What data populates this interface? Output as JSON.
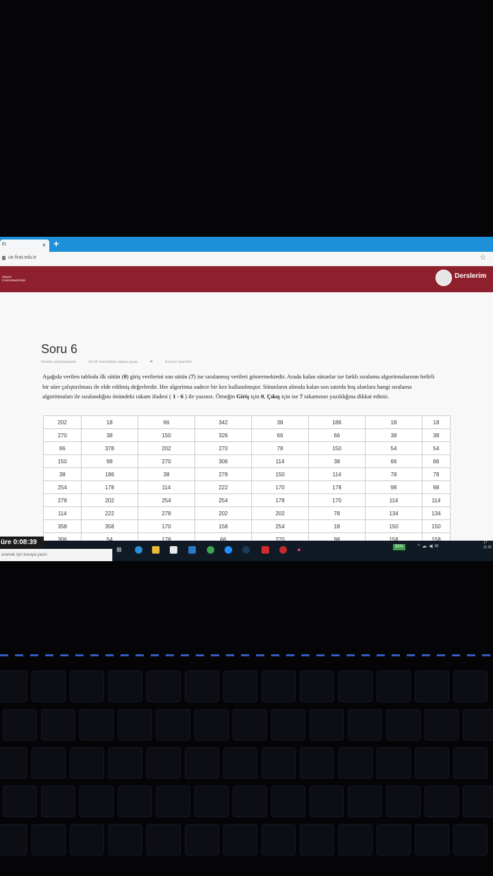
{
  "browser": {
    "tab_title": "Fi",
    "url": "ue.firat.edu.tr"
  },
  "header": {
    "logo_line1": "FIRAT",
    "logo_line2": "ÜNİVERSİTESİ",
    "nav_label": "Derslerim"
  },
  "question": {
    "title": "Soru 6",
    "status": "Henüz yanıtlanmadı",
    "points": "18.00 üzerinden alınan puan",
    "flag": "Soruyu işaretle",
    "text": [
      {
        "t": "Aşağıda verilen tabloda ilk sütün (",
        "b": false
      },
      {
        "t": "0",
        "b": true
      },
      {
        "t": ") giriş verilerini son sütün (",
        "b": false
      },
      {
        "t": "7",
        "b": true
      },
      {
        "t": ") ise sıralanmış verileri göstermektedir. Arada kalan sütunlar ise farklı sıralama algoritmalarının belirli bir süre çalıştırılması ile elde edilmiş değerlerdir. Her algoritma sadece bir kez kullanılmıştır. Sütunların altında kalan son satırda boş alanlara hangi sıralama algoritmaları ile sıralandığını önündeki rakam ifadesi (",
        "b": false
      },
      {
        "t": " 1 - 6 ",
        "b": true
      },
      {
        "t": ") ile yazınız. Örneğin ",
        "b": false
      },
      {
        "t": "Giriş",
        "b": true
      },
      {
        "t": " için ",
        "b": false
      },
      {
        "t": "0",
        "b": true
      },
      {
        "t": ", ",
        "b": false
      },
      {
        "t": "Çıkış",
        "b": true
      },
      {
        "t": " için ise ",
        "b": false
      },
      {
        "t": "7",
        "b": true
      },
      {
        "t": " rakamının yazıldığına dikkat ediniz.",
        "b": false
      }
    ]
  },
  "table": {
    "rows": [
      [
        "202",
        "18",
        "66",
        "342",
        "38",
        "186",
        "18",
        "18"
      ],
      [
        "270",
        "38",
        "150",
        "326",
        "66",
        "66",
        "38",
        "38"
      ],
      [
        "66",
        "378",
        "202",
        "270",
        "78",
        "150",
        "54",
        "54"
      ],
      [
        "150",
        "98",
        "270",
        "306",
        "114",
        "38",
        "66",
        "66"
      ],
      [
        "38",
        "186",
        "38",
        "278",
        "150",
        "114",
        "78",
        "78"
      ],
      [
        "254",
        "178",
        "114",
        "222",
        "170",
        "178",
        "98",
        "98"
      ],
      [
        "278",
        "202",
        "254",
        "254",
        "178",
        "170",
        "114",
        "114"
      ],
      [
        "114",
        "222",
        "278",
        "202",
        "202",
        "78",
        "134",
        "134"
      ],
      [
        "358",
        "358",
        "170",
        "158",
        "254",
        "18",
        "150",
        "150"
      ],
      [
        "306",
        "54",
        "178",
        "66",
        "270",
        "98",
        "158",
        "158"
      ]
    ]
  },
  "timer": {
    "label": "üre 0:08:39"
  },
  "taskbar": {
    "search_placeholder": "aramak için buraya yazın",
    "battery": "95%",
    "clock_line1": "17",
    "clock_line2": "11.01"
  },
  "colors": {
    "accent_blue": "#1e8fd9",
    "header_red": "#8e1f2c"
  }
}
